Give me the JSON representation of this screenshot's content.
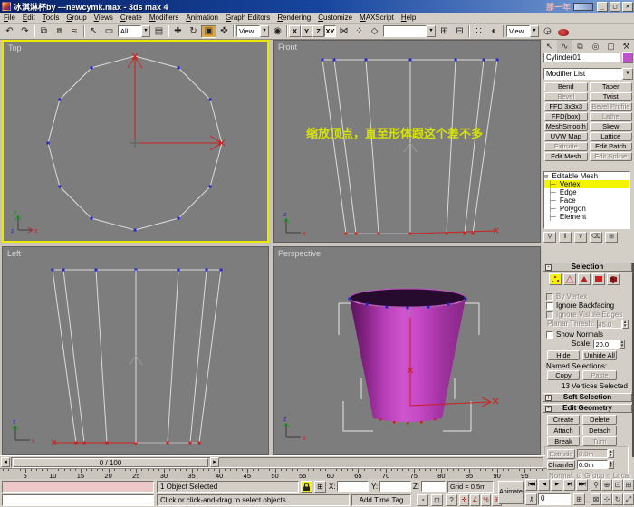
{
  "window": {
    "title": "冰淇淋杯by ---newcymk.max - 3ds max 4",
    "overlay_text": "那一年",
    "minimize": "_",
    "restore": "□",
    "close": "✕"
  },
  "menu": {
    "items": [
      "File",
      "Edit",
      "Tools",
      "Group",
      "Views",
      "Create",
      "Modifiers",
      "Animation",
      "Graph Editors",
      "Rendering",
      "Customize",
      "MAXScript",
      "Help"
    ]
  },
  "toolbar": {
    "selection_filter_value": "All",
    "ref_coord_value": "View",
    "view_combo_value": "View",
    "named_selection_value": "",
    "axis_buttons": [
      "X",
      "Y",
      "Z",
      "XY"
    ],
    "icons": [
      "undo-icon",
      "redo-icon",
      "select-and-link-icon",
      "unlink-selection-icon",
      "bind-to-space-warp-icon",
      "select-object-icon",
      "rect-selection-region-icon",
      "select-by-name-icon",
      "select-and-move-icon",
      "select-and-rotate-icon",
      "select-and-scale-icon",
      "select-and-manipulate-icon",
      "use-pivot-center-icon",
      "mirror-icon",
      "array-icon",
      "align-icon",
      "track-view-icon",
      "schematic-view-icon",
      "material-editor-icon",
      "render-scene-icon",
      "render-type-icon",
      "render-quick-icon"
    ]
  },
  "viewports": {
    "top": {
      "label": "Top"
    },
    "front": {
      "label": "Front",
      "annotation": "缩放顶点，直至形体跟这个差不多"
    },
    "left": {
      "label": "Left"
    },
    "perspective": {
      "label": "Perspective"
    }
  },
  "panel": {
    "tabs": [
      "create",
      "modify",
      "hierarchy",
      "motion",
      "display",
      "utilities"
    ],
    "object_name": "Cylinder01",
    "modifier_list_label": "Modifier List",
    "modifier_buttons": [
      {
        "label": "Bend",
        "enabled": true
      },
      {
        "label": "Taper",
        "enabled": true
      },
      {
        "label": "Bevel",
        "enabled": false
      },
      {
        "label": "Twist",
        "enabled": true
      },
      {
        "label": "FFD 3x3x3",
        "enabled": true
      },
      {
        "label": "Bevel Profile",
        "enabled": false
      },
      {
        "label": "FFD(box)",
        "enabled": true
      },
      {
        "label": "Lathe",
        "enabled": false
      },
      {
        "label": "MeshSmooth",
        "enabled": true
      },
      {
        "label": "Skew",
        "enabled": true
      },
      {
        "label": "UVW Map",
        "enabled": true
      },
      {
        "label": "Lattice",
        "enabled": true
      },
      {
        "label": "Extrude",
        "enabled": false
      },
      {
        "label": "Edit Patch",
        "enabled": true
      },
      {
        "label": "Edit Mesh",
        "enabled": true
      },
      {
        "label": "Edit Spline",
        "enabled": false
      }
    ],
    "stack": {
      "root": "Editable Mesh",
      "items": [
        "Vertex",
        "Edge",
        "Face",
        "Polygon",
        "Element"
      ],
      "selected": "Vertex"
    },
    "selection_rollout": {
      "title": "Selection",
      "by_vertex": "By Vertex",
      "ignore_backfacing": "Ignore Backfacing",
      "ignore_visible_edges": "Ignore Visible Edges",
      "planar_thresh_label": "Planar Thresh:",
      "planar_thresh_value": "45.0",
      "show_normals": "Show Normals",
      "scale_label": "Scale:",
      "scale_value": "20.0",
      "hide": "Hide",
      "unhide_all": "Unhide All",
      "named_selections": "Named Selections:",
      "copy": "Copy",
      "paste": "Paste",
      "status": "13 Vertices Selected"
    },
    "soft_selection_title": "Soft Selection",
    "edit_geometry": {
      "title": "Edit Geometry",
      "create": "Create",
      "delete": "Delete",
      "attach": "Attach",
      "detach": "Detach",
      "break": "Break",
      "turn": "Turn",
      "extrude": "Extrude",
      "extrude_value": "0.0m",
      "chamfer": "Chamfer",
      "chamfer_value": "0.0m",
      "normal_label": "Normal:",
      "group": "Group",
      "local": "Local"
    }
  },
  "timeline": {
    "slider_label": "0 / 100",
    "start": 0,
    "end": 100,
    "label_step": 5
  },
  "status": {
    "line1": "1 Object Selected",
    "line2": "Click or click-and-drag to select objects",
    "x_label": "X:",
    "y_label": "Y:",
    "z_label": "Z:",
    "grid": "Grid = 0.5m",
    "add_time_tag": "Add Time Tag",
    "animate": "Animate",
    "frame_value": "0"
  }
}
